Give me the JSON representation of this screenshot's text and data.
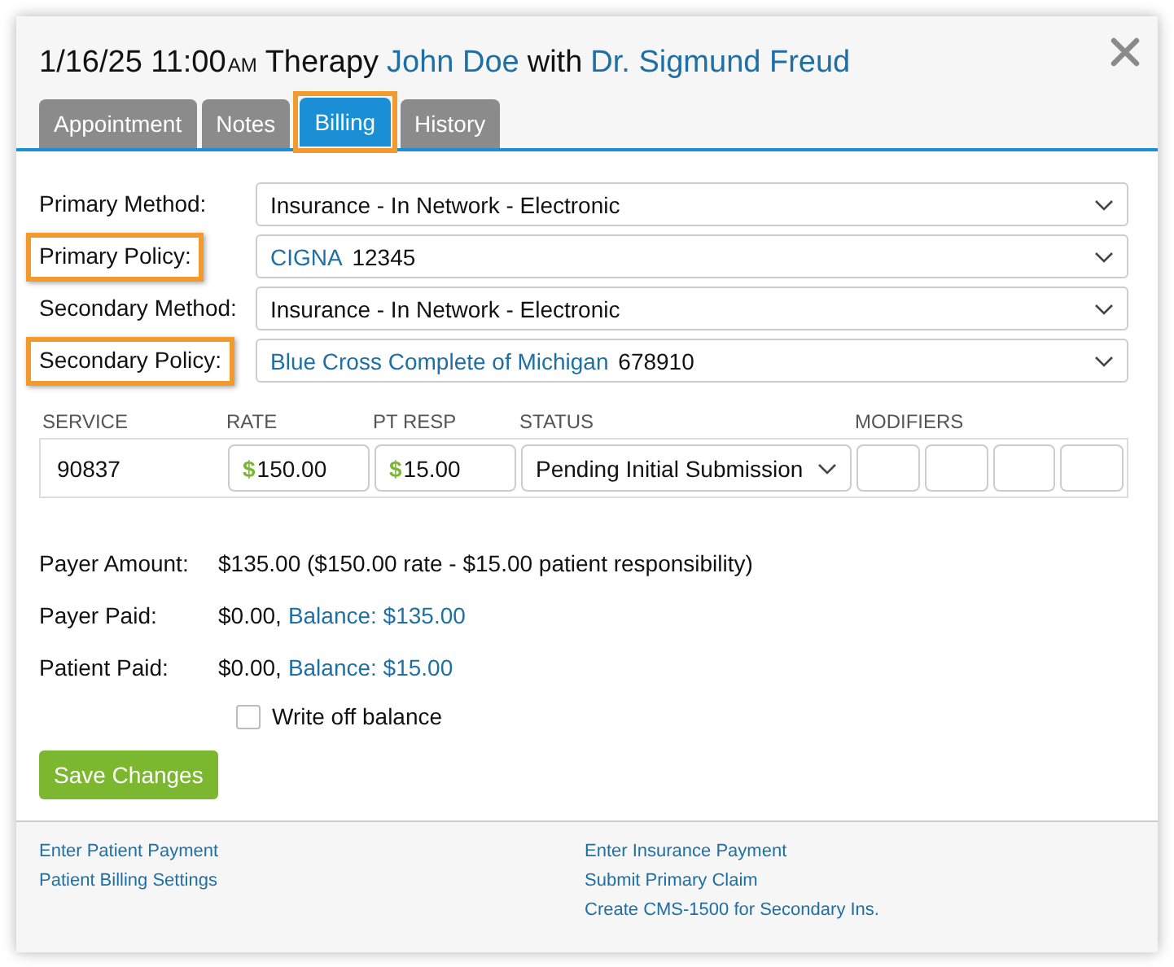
{
  "header": {
    "datetime": "1/16/25 11:00",
    "meridiem": "AM",
    "type": "Therapy",
    "patient": "John Doe",
    "joiner": "with",
    "provider": "Dr. Sigmund Freud"
  },
  "tabs": [
    {
      "label": "Appointment",
      "selected": false,
      "highlighted": false
    },
    {
      "label": "Notes",
      "selected": false,
      "highlighted": false
    },
    {
      "label": "Billing",
      "selected": true,
      "highlighted": true
    },
    {
      "label": "History",
      "selected": false,
      "highlighted": false
    }
  ],
  "fields": [
    {
      "kind": "method",
      "label": "Primary Method:",
      "highlighted": false,
      "value": "Insurance - In Network - Electronic"
    },
    {
      "kind": "policy",
      "label": "Primary Policy:",
      "highlighted": true,
      "insurer": "CIGNA",
      "number": "12345"
    },
    {
      "kind": "method",
      "label": "Secondary Method:",
      "highlighted": false,
      "value": "Insurance - In Network - Electronic"
    },
    {
      "kind": "policy",
      "label": "Secondary Policy:",
      "highlighted": true,
      "insurer": "Blue Cross Complete of Michigan",
      "number": "678910"
    }
  ],
  "service_table": {
    "columns": [
      "SERVICE",
      "RATE",
      "PT RESP",
      "STATUS",
      "MODIFIERS"
    ],
    "row": {
      "service": "90837",
      "currency": "$",
      "rate": "150.00",
      "pt_resp": "15.00",
      "status": "Pending Initial Submission"
    }
  },
  "summary": [
    {
      "label": "Payer Amount:",
      "amount": "$135.00 ($150.00 rate - $15.00 patient responsibility)"
    },
    {
      "label": "Payer Paid:",
      "amount": "$0.00,",
      "balance": "Balance: $135.00"
    },
    {
      "label": "Patient Paid:",
      "amount": "$0.00,",
      "balance": "Balance: $15.00"
    }
  ],
  "write_off": {
    "label": "Write off balance",
    "checked": false
  },
  "save_button": "Save Changes",
  "footer_links": {
    "left": [
      "Enter Patient Payment",
      "Patient Billing Settings"
    ],
    "right": [
      "Enter Insurance Payment",
      "Submit Primary Claim",
      "Create CMS-1500 for Secondary Ins."
    ]
  }
}
